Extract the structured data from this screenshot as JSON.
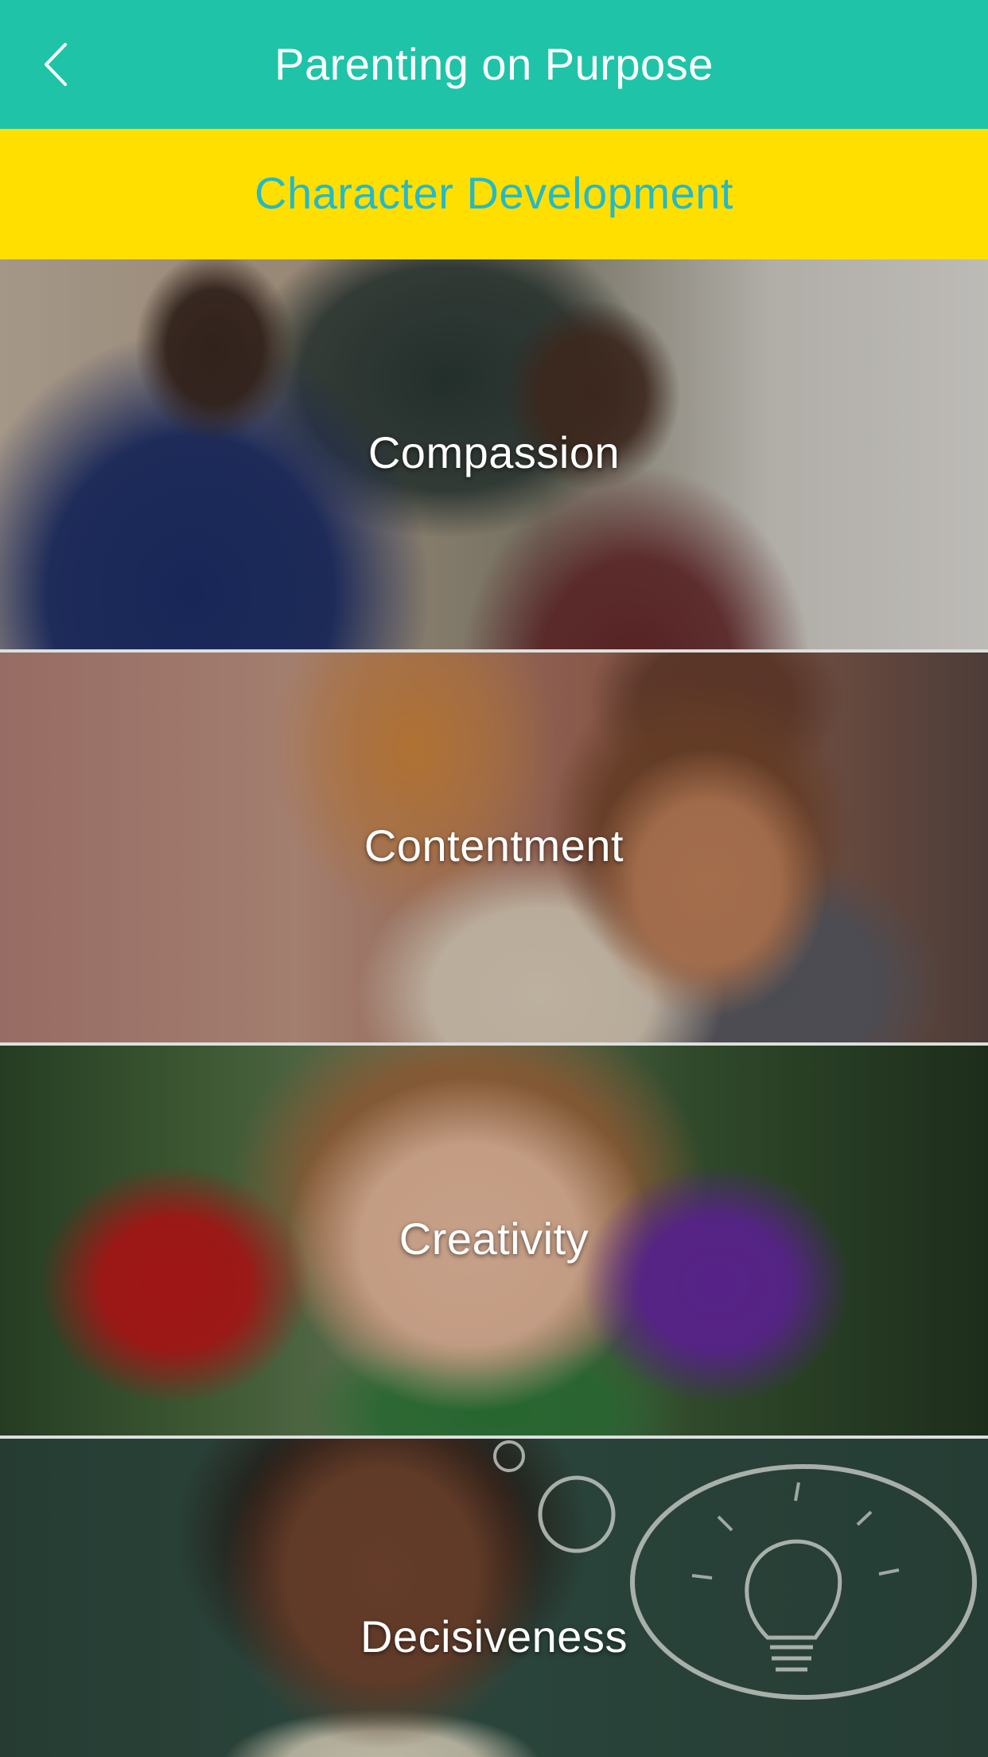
{
  "header": {
    "title": "Parenting on Purpose",
    "back_icon": "chevron-left-icon"
  },
  "section": {
    "title": "Character Development"
  },
  "topics": [
    {
      "label": "Compassion"
    },
    {
      "label": "Contentment"
    },
    {
      "label": "Creativity"
    },
    {
      "label": "Decisiveness"
    }
  ],
  "colors": {
    "nav_background": "#1fc4a8",
    "banner_background": "#ffdf00",
    "banner_text": "#25b9c8",
    "nav_text": "#ffffff",
    "tile_label_text": "#ffffff"
  }
}
